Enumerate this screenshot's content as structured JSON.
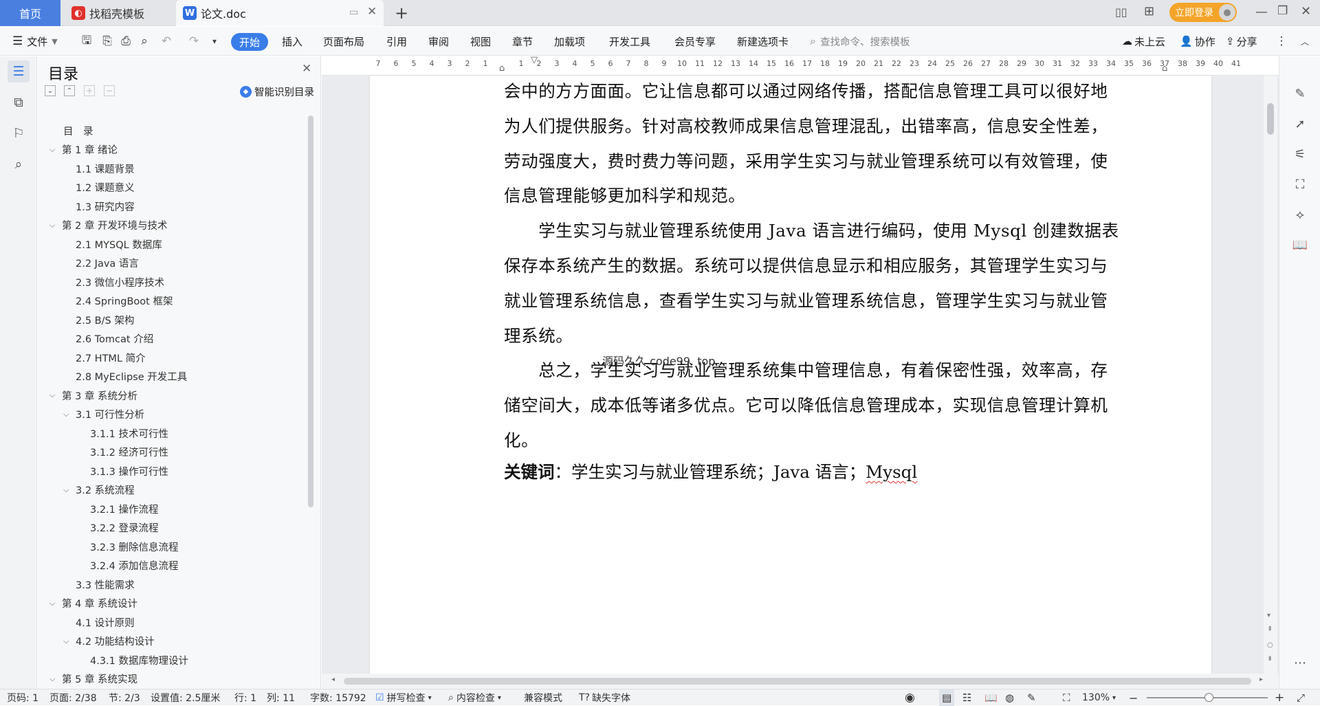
{
  "tabs": {
    "home": "首页",
    "template": "找稻壳模板",
    "doc": "论文.doc",
    "new_tab": "+"
  },
  "header": {
    "login": "立即登录"
  },
  "toolbar": {
    "file": "文件",
    "tabs": [
      "开始",
      "插入",
      "页面布局",
      "引用",
      "审阅",
      "视图",
      "章节",
      "加载项",
      "开发工具",
      "会员专享",
      "新建选项卡"
    ],
    "search_placeholder": "查找命令、搜索模板",
    "cloud": "未上云",
    "collab": "协作",
    "share": "分享"
  },
  "toc": {
    "title": "目录",
    "smart": "智能识别目录",
    "items": [
      {
        "label": "目　录",
        "level": 0,
        "chev": ""
      },
      {
        "label": "第 1 章  绪论",
        "level": 0,
        "chev": "v"
      },
      {
        "label": "1.1  课题背景",
        "level": 1,
        "chev": ""
      },
      {
        "label": "1.2  课题意义",
        "level": 1,
        "chev": ""
      },
      {
        "label": "1.3  研究内容",
        "level": 1,
        "chev": ""
      },
      {
        "label": "第 2 章  开发环境与技术",
        "level": 0,
        "chev": "v"
      },
      {
        "label": "2.1 MYSQL 数据库",
        "level": 1,
        "chev": ""
      },
      {
        "label": "2.2 Java 语言",
        "level": 1,
        "chev": ""
      },
      {
        "label": "2.3  微信小程序技术",
        "level": 1,
        "chev": ""
      },
      {
        "label": "2.4 SpringBoot 框架",
        "level": 1,
        "chev": ""
      },
      {
        "label": "2.5 B/S 架构",
        "level": 1,
        "chev": ""
      },
      {
        "label": "2.6 Tomcat  介绍",
        "level": 1,
        "chev": ""
      },
      {
        "label": "2.7 HTML 简介",
        "level": 1,
        "chev": ""
      },
      {
        "label": "2.8 MyEclipse 开发工具",
        "level": 1,
        "chev": ""
      },
      {
        "label": "第 3 章  系统分析",
        "level": 0,
        "chev": "v"
      },
      {
        "label": "3.1  可行性分析",
        "level": 1,
        "chev": "v"
      },
      {
        "label": "3.1.1  技术可行性",
        "level": 2,
        "chev": ""
      },
      {
        "label": "3.1.2  经济可行性",
        "level": 2,
        "chev": ""
      },
      {
        "label": "3.1.3  操作可行性",
        "level": 2,
        "chev": ""
      },
      {
        "label": "3.2  系统流程",
        "level": 1,
        "chev": "v"
      },
      {
        "label": "3.2.1  操作流程",
        "level": 2,
        "chev": ""
      },
      {
        "label": "3.2.2  登录流程",
        "level": 2,
        "chev": ""
      },
      {
        "label": "3.2.3  删除信息流程",
        "level": 2,
        "chev": ""
      },
      {
        "label": "3.2.4  添加信息流程",
        "level": 2,
        "chev": ""
      },
      {
        "label": "3.3  性能需求",
        "level": 1,
        "chev": ""
      },
      {
        "label": "第 4 章  系统设计",
        "level": 0,
        "chev": "v"
      },
      {
        "label": "4.1  设计原则",
        "level": 1,
        "chev": ""
      },
      {
        "label": "4.2  功能结构设计",
        "level": 1,
        "chev": "v"
      },
      {
        "label": "4.3.1  数据库物理设计",
        "level": 2,
        "chev": ""
      },
      {
        "label": "第 5 章  系统实现",
        "level": 0,
        "chev": "v"
      }
    ]
  },
  "ruler": {
    "ticks": [
      "7",
      "6",
      "5",
      "4",
      "3",
      "2",
      "1",
      "",
      "1",
      "2",
      "3",
      "4",
      "5",
      "6",
      "7",
      "8",
      "9",
      "10",
      "11",
      "12",
      "13",
      "14",
      "15",
      "16",
      "17",
      "18",
      "19",
      "20",
      "21",
      "22",
      "23",
      "24",
      "25",
      "26",
      "27",
      "28",
      "29",
      "30",
      "31",
      "32",
      "33",
      "34",
      "35",
      "36",
      "37",
      "38",
      "39",
      "40",
      "41"
    ]
  },
  "doc": {
    "lines": [
      "会中的方方面面。它让信息都可以通过网络传播，搭配信息管理工具可以很好地",
      "为人们提供服务。针对高校教师成果信息管理混乱，出错率高，信息安全性差，",
      "劳动强度大，费时费力等问题，采用学生实习与就业管理系统可以有效管理，使",
      "信息管理能够更加科学和规范。",
      "　　学生实习与就业管理系统使用 Java 语言进行编码，使用 Mysql 创建数据表",
      "保存本系统产生的数据。系统可以提供信息显示和相应服务，其管理学生实习与",
      "就业管理系统信息，查看学生实习与就业管理系统信息，管理学生实习与就业管",
      "理系统。",
      "　　总之，学生实习与就业管理系统集中管理信息，有着保密性强，效率高，存",
      "储空间大，成本低等诸多优点。它可以降低信息管理成本，实现信息管理计算机",
      "化。"
    ],
    "keywords_label": "关键词",
    "keywords_text": "：学生实习与就业管理系统；Java 语言；",
    "keywords_mysql": "Mysql",
    "watermark": "源码久久 code99. top"
  },
  "status": {
    "page_code": "页码: 1",
    "page": "页面: 2/38",
    "section": "节: 2/3",
    "setting": "设置值: 2.5厘米",
    "row": "行: 1",
    "col": "列: 11",
    "wordcount": "字数: 15792",
    "spell": "拼写检查",
    "content": "内容检查",
    "compat": "兼容模式",
    "missing_font": "缺失字体",
    "zoom": "130%"
  }
}
